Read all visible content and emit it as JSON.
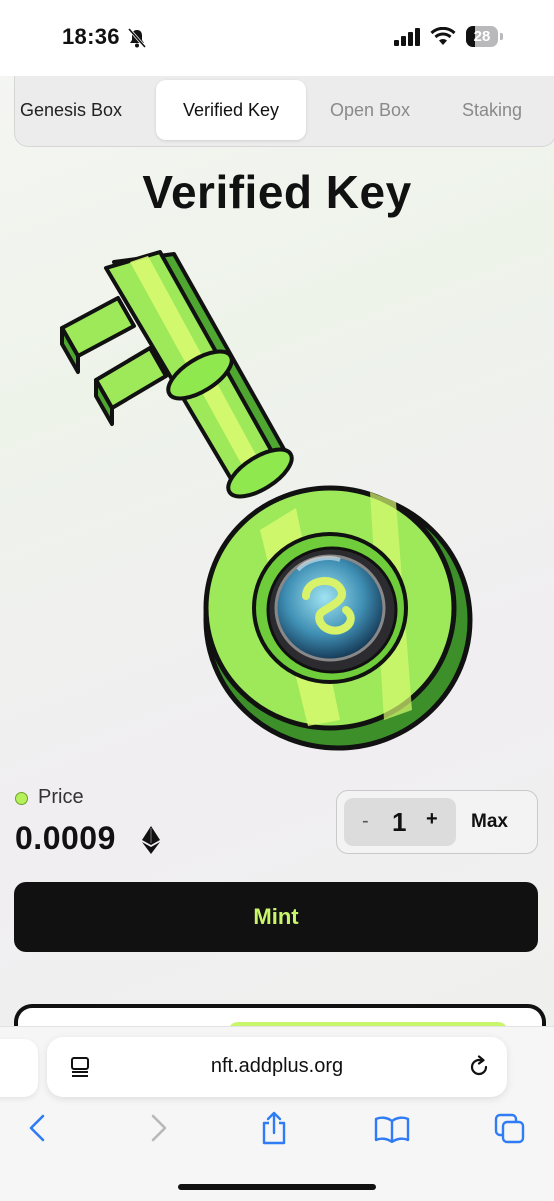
{
  "status_bar": {
    "time": "18:36",
    "battery": "28"
  },
  "tabs": [
    {
      "label": "Genesis Box",
      "active": false
    },
    {
      "label": "Verified Key",
      "active": true
    },
    {
      "label": "Open Box",
      "active": false
    },
    {
      "label": "Staking",
      "active": false
    }
  ],
  "title": "Verified Key",
  "price": {
    "label": "Price",
    "value": "0.0009",
    "currency_icon": "ethereum-icon"
  },
  "quantity": {
    "minus": "-",
    "value": "1",
    "plus": "+",
    "max_label": "Max"
  },
  "mint_label": "Mint",
  "browser": {
    "url": "nft.addplus.org"
  },
  "colors": {
    "accent": "#c9f56b",
    "key_green": "#8ee84e",
    "dark": "#111111"
  }
}
